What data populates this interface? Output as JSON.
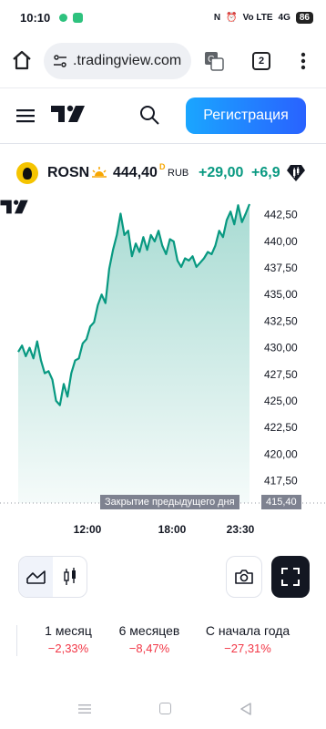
{
  "status_bar": {
    "time": "10:10",
    "network": "Vo LTE",
    "signal": "4G",
    "battery": "86"
  },
  "browser": {
    "url": ".tradingview.com",
    "tab_count": "2"
  },
  "site_header": {
    "register_label": "Регистрация"
  },
  "ticker": {
    "symbol": "ROSN",
    "price": "444,40",
    "price_flag": "D",
    "currency": "RUB",
    "change_abs": "+29,00",
    "change_pct": "+6,9",
    "positive_color": "#089981"
  },
  "chart_data": {
    "type": "area",
    "x_ticks": [
      "12:00",
      "18:00",
      "23:30"
    ],
    "y_ticks": [
      "442,50",
      "440,00",
      "437,50",
      "435,00",
      "432,50",
      "430,00",
      "427,50",
      "425,00",
      "422,50",
      "420,00",
      "417,50"
    ],
    "ylim": [
      415.4,
      443.5
    ],
    "previous_close_label": "Закрытие предыдущего дня",
    "previous_close_value": "415,40",
    "previous_close": 415.4,
    "series": [
      {
        "values": [
          429.6,
          430.2,
          429.2,
          430.0,
          429.0,
          430.6,
          428.8,
          427.6,
          427.8,
          427.0,
          425.0,
          424.6,
          426.6,
          425.4,
          427.6,
          428.8,
          429.0,
          430.4,
          430.8,
          432.0,
          432.4,
          434.0,
          435.0,
          434.2,
          437.4,
          439.2,
          440.6,
          442.6,
          440.6,
          441.0,
          438.6,
          439.8,
          439.0,
          440.4,
          439.2,
          440.6,
          440.0,
          441.0,
          439.6,
          438.8,
          440.2,
          440.0,
          438.2,
          437.6,
          438.4,
          438.2,
          438.6,
          437.6,
          438.0,
          438.4,
          439.0,
          438.8,
          439.6,
          441.0,
          440.4,
          442.0,
          442.8,
          441.6,
          443.4,
          441.8,
          442.6,
          443.5
        ],
        "color": "#089981"
      }
    ]
  },
  "toolbar": {
    "chart_type": "area"
  },
  "performance": [
    {
      "label": "1 месяц",
      "value": "−2,33%"
    },
    {
      "label": "6 месяцев",
      "value": "−8,47%"
    },
    {
      "label": "С начала года",
      "value": "−27,31%"
    }
  ]
}
